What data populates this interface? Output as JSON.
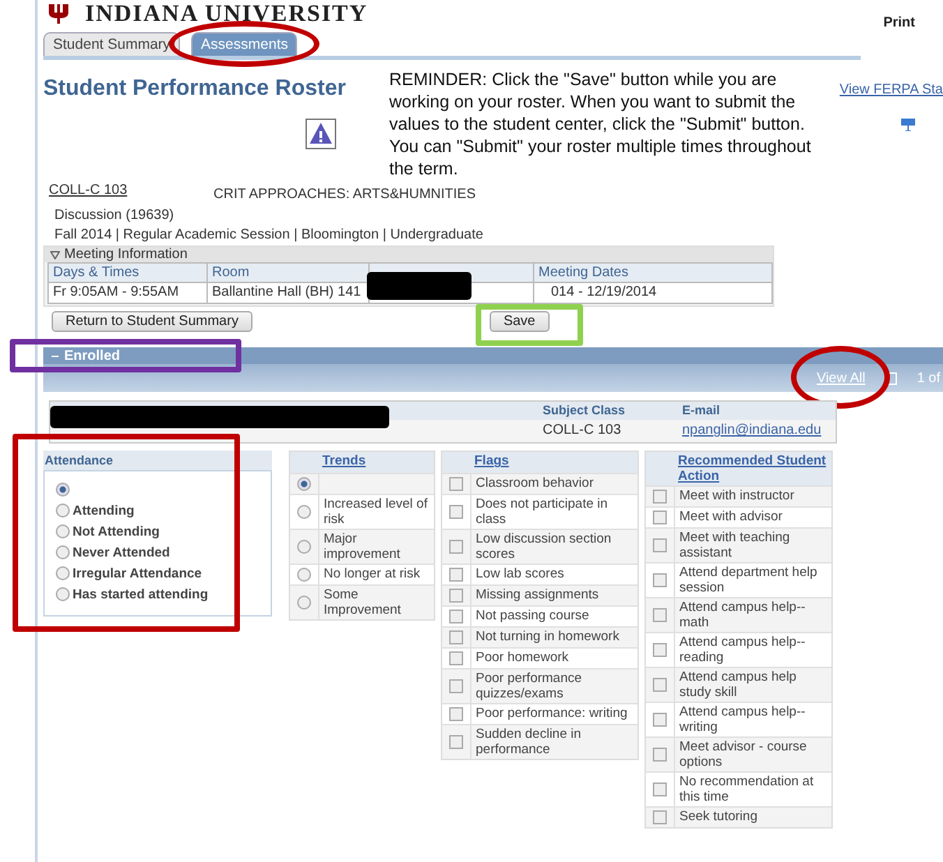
{
  "header": {
    "university": "INDIANA UNIVERSITY",
    "print": "Print"
  },
  "tabs": [
    {
      "label": "Student Summary",
      "selected": false
    },
    {
      "label": "Assessments",
      "selected": true
    }
  ],
  "title": "Student Performance Roster",
  "reminder": "REMINDER: Click the \"Save\" button while you are working on your roster. When you want to submit the values to the student center, click the \"Submit\" button. You can \"Submit\" your roster multiple times throughout the term.",
  "ferpa_link": "View FERPA Sta",
  "course": {
    "code": "COLL-C 103",
    "title": "CRIT APPROACHES: ARTS&HUMNITIES",
    "section": "Discussion  (19639)",
    "session": "Fall 2014 | Regular Academic Session | Bloomington | Undergraduate"
  },
  "meeting": {
    "heading": "Meeting Information",
    "expanded": true,
    "columns": [
      "Days & Times",
      "Room",
      "Meeting Dates"
    ],
    "row": [
      "Fr 9:05AM - 9:55AM",
      "Ballantine Hall (BH) 141",
      "014 - 12/19/2014"
    ]
  },
  "buttons": {
    "return": "Return to Student Summary",
    "save": "Save"
  },
  "enrolled": {
    "title": "Enrolled",
    "expanded": true,
    "view_all": "View All",
    "pager": "1 of"
  },
  "student_table": {
    "columns": [
      "Subject Class",
      "E-mail"
    ],
    "row": [
      "COLL-C 103",
      "npanglin@indiana.edu"
    ]
  },
  "attendance": {
    "title": "Attendance",
    "options": [
      {
        "selected": true
      },
      {
        "label": "Attending",
        "selected": false
      },
      {
        "label": "Not Attending",
        "selected": false
      },
      {
        "label": "Never Attended",
        "selected": false
      },
      {
        "label": "Irregular Attendance",
        "selected": false
      },
      {
        "label": "Has started attending",
        "selected": false
      }
    ]
  },
  "trends": {
    "title": "Trends",
    "options": [
      {
        "selected": true
      },
      {
        "label": "Increased level of risk",
        "selected": false
      },
      {
        "label": "Major improvement",
        "selected": false
      },
      {
        "label": "No longer at risk",
        "selected": false
      },
      {
        "label": "Some Improvement",
        "selected": false
      }
    ]
  },
  "flags": {
    "title": "Flags",
    "items": [
      {
        "label": "Classroom behavior",
        "checked": false
      },
      {
        "label": "Does not participate in class",
        "checked": false
      },
      {
        "label": "Low discussion section scores",
        "checked": false
      },
      {
        "label": "Low lab scores",
        "checked": false
      },
      {
        "label": "Missing assignments",
        "checked": false
      },
      {
        "label": "Not passing course",
        "checked": false
      },
      {
        "label": "Not turning in homework",
        "checked": false
      },
      {
        "label": "Poor homework",
        "checked": false
      },
      {
        "label": "Poor performance quizzes/exams",
        "checked": false
      },
      {
        "label": "Poor performance: writing",
        "checked": false
      },
      {
        "label": "Sudden decline in performance",
        "checked": false
      }
    ]
  },
  "actions": {
    "title": "Recommended Student Action",
    "items": [
      {
        "label": "Meet with instructor",
        "checked": false
      },
      {
        "label": "Meet with advisor",
        "checked": false
      },
      {
        "label": "Meet with teaching assistant",
        "checked": false
      },
      {
        "label": "Attend department help session",
        "checked": false
      },
      {
        "label": "Attend campus help--math",
        "checked": false
      },
      {
        "label": "Attend campus help--reading",
        "checked": false
      },
      {
        "label": "Attend campus help study skill",
        "checked": false
      },
      {
        "label": "Attend campus help--writing",
        "checked": false
      },
      {
        "label": "Meet advisor - course options",
        "checked": false
      },
      {
        "label": "No recommendation at this time",
        "checked": false
      },
      {
        "label": "Seek tutoring",
        "checked": false
      }
    ]
  },
  "annotations": [
    {
      "kind": "ellipse",
      "color": "#c00000"
    },
    {
      "kind": "rect",
      "color": "#8fd14f"
    },
    {
      "kind": "rect",
      "color": "#7030a0"
    },
    {
      "kind": "ellipse",
      "color": "#c00000"
    },
    {
      "kind": "rect",
      "color": "#c00000"
    }
  ]
}
